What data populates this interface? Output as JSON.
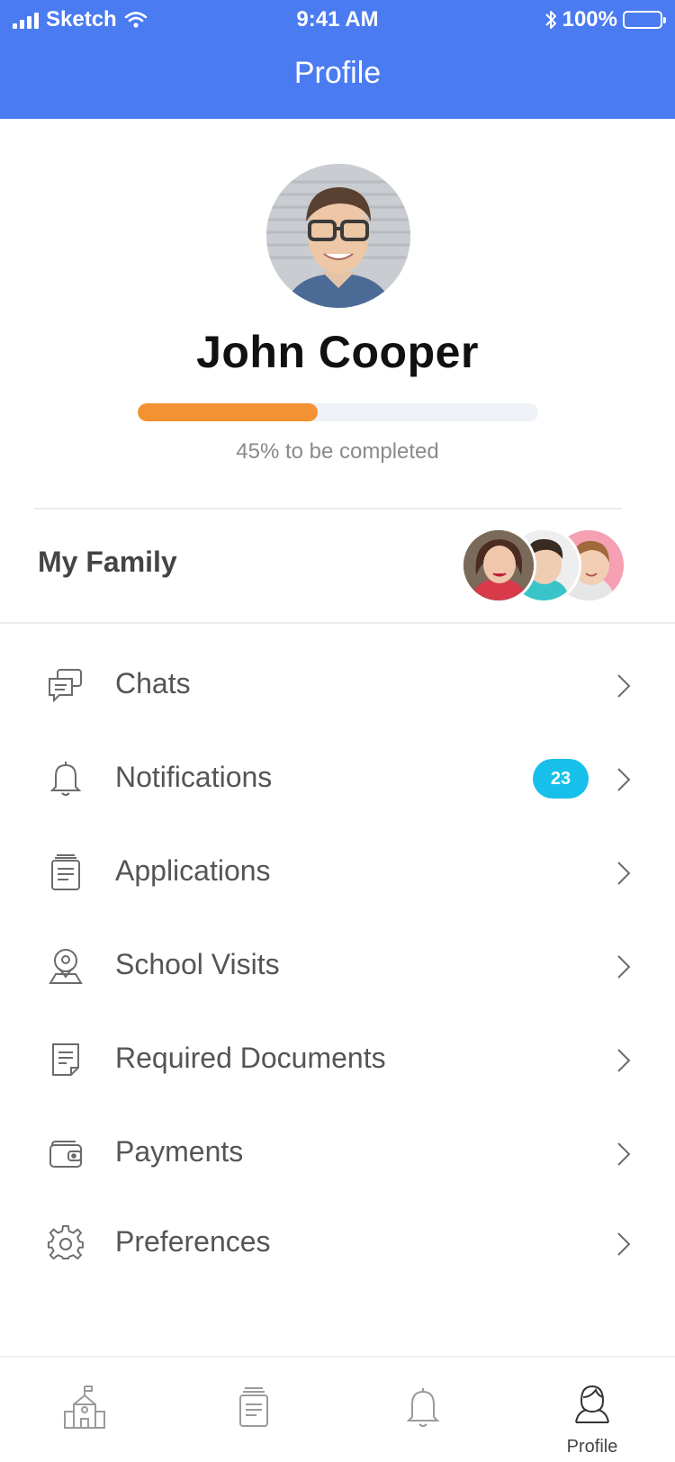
{
  "status_bar": {
    "carrier": "Sketch",
    "time": "9:41 AM",
    "battery": "100%"
  },
  "header": {
    "title": "Profile"
  },
  "profile": {
    "name": "John Cooper",
    "completion_fraction": 0.45,
    "completion_text": "45% to be completed"
  },
  "family": {
    "label": "My Family"
  },
  "menu": {
    "items": [
      {
        "label": "Chats",
        "icon": "chat-icon"
      },
      {
        "label": "Notifications",
        "icon": "bell-icon",
        "badge": "23"
      },
      {
        "label": "Applications",
        "icon": "document-stack-icon"
      },
      {
        "label": "School Visits",
        "icon": "location-pin-icon"
      },
      {
        "label": "Required Documents",
        "icon": "document-icon"
      },
      {
        "label": "Payments",
        "icon": "wallet-icon"
      },
      {
        "label": "Preferences",
        "icon": "gear-icon"
      }
    ]
  },
  "tabbar": {
    "tabs": [
      {
        "icon": "school-icon",
        "label": ""
      },
      {
        "icon": "document-stack-icon",
        "label": ""
      },
      {
        "icon": "bell-icon",
        "label": ""
      },
      {
        "icon": "user-icon",
        "label": "Profile"
      }
    ]
  },
  "colors": {
    "header": "#4a7bf1",
    "progress": "#f39232",
    "badge": "#17c0ea"
  }
}
